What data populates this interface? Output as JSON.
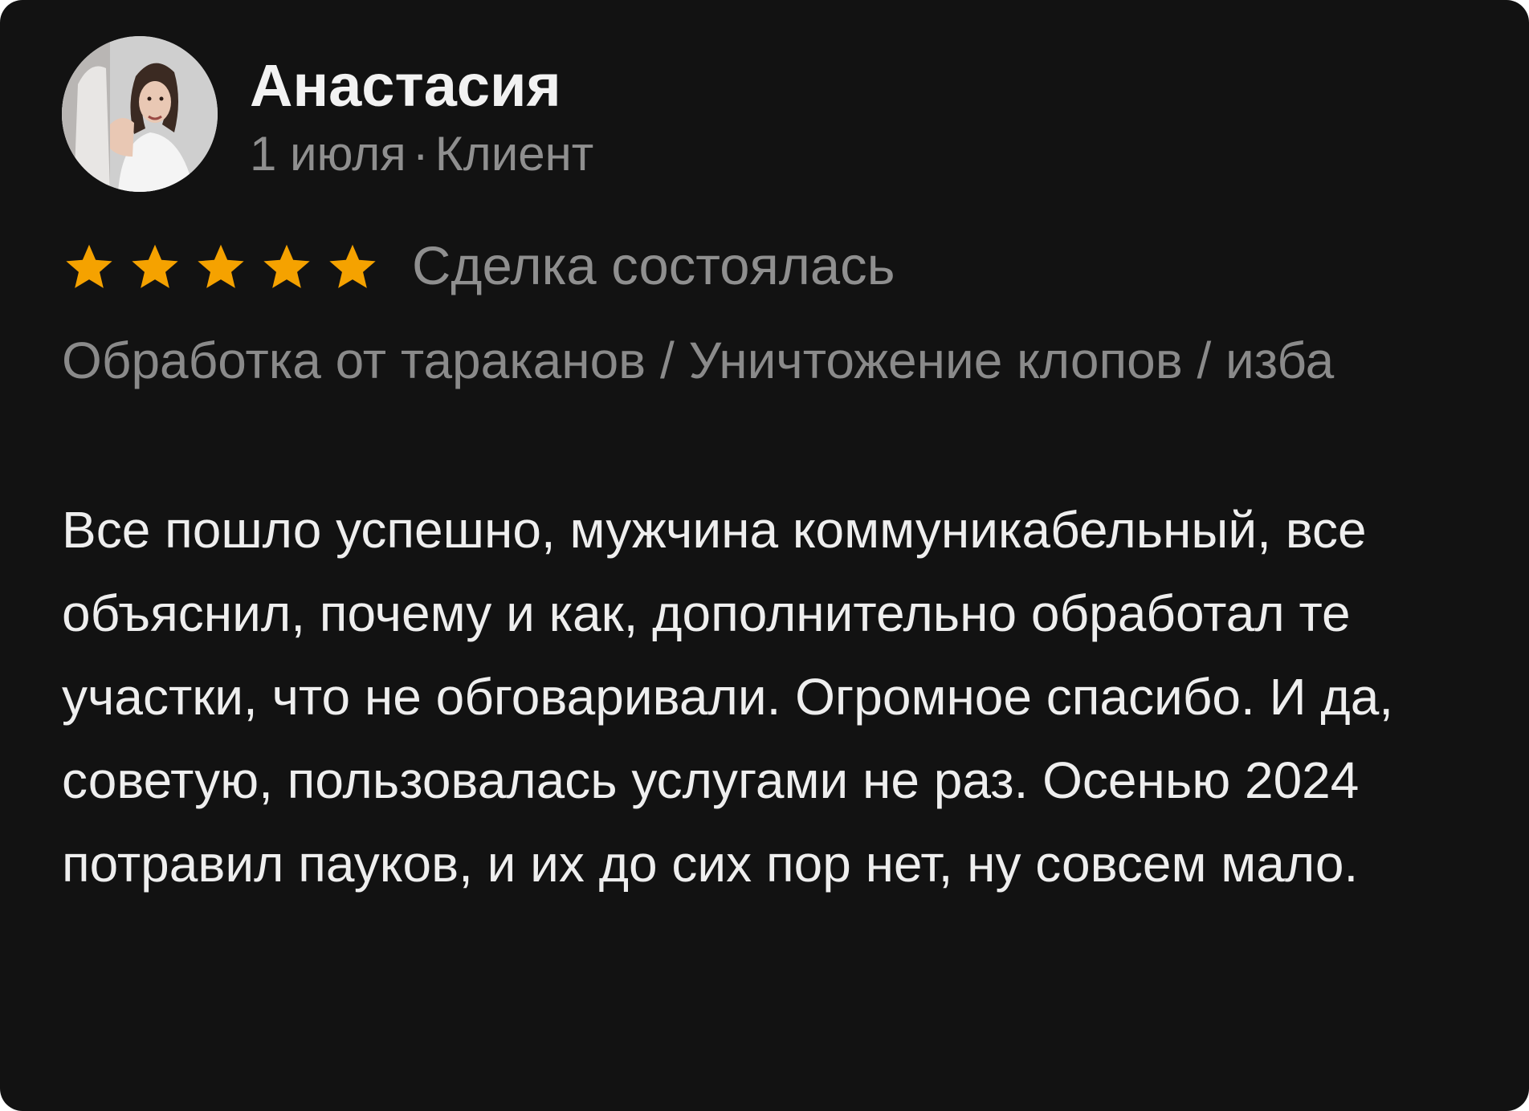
{
  "review": {
    "author_name": "Анастасия",
    "date": "1 июля",
    "separator": "·",
    "role": "Клиент",
    "rating": 5,
    "rating_max": 5,
    "star_color": "#f5a200",
    "deal_status": "Сделка состоялась",
    "service": "Обработка от тараканов / Уничтожение клопов / изба",
    "text": "Все пошло успешно, мужчина коммуникабельный, все объяснил, почему и как, дополнительно обработал те участки, что не обговаривали. Огромное спасибо. И да, советую, пользовалась услугами не раз. Осенью 2024 потравил пауков, и их до сих пор нет, ну совсем мало."
  }
}
